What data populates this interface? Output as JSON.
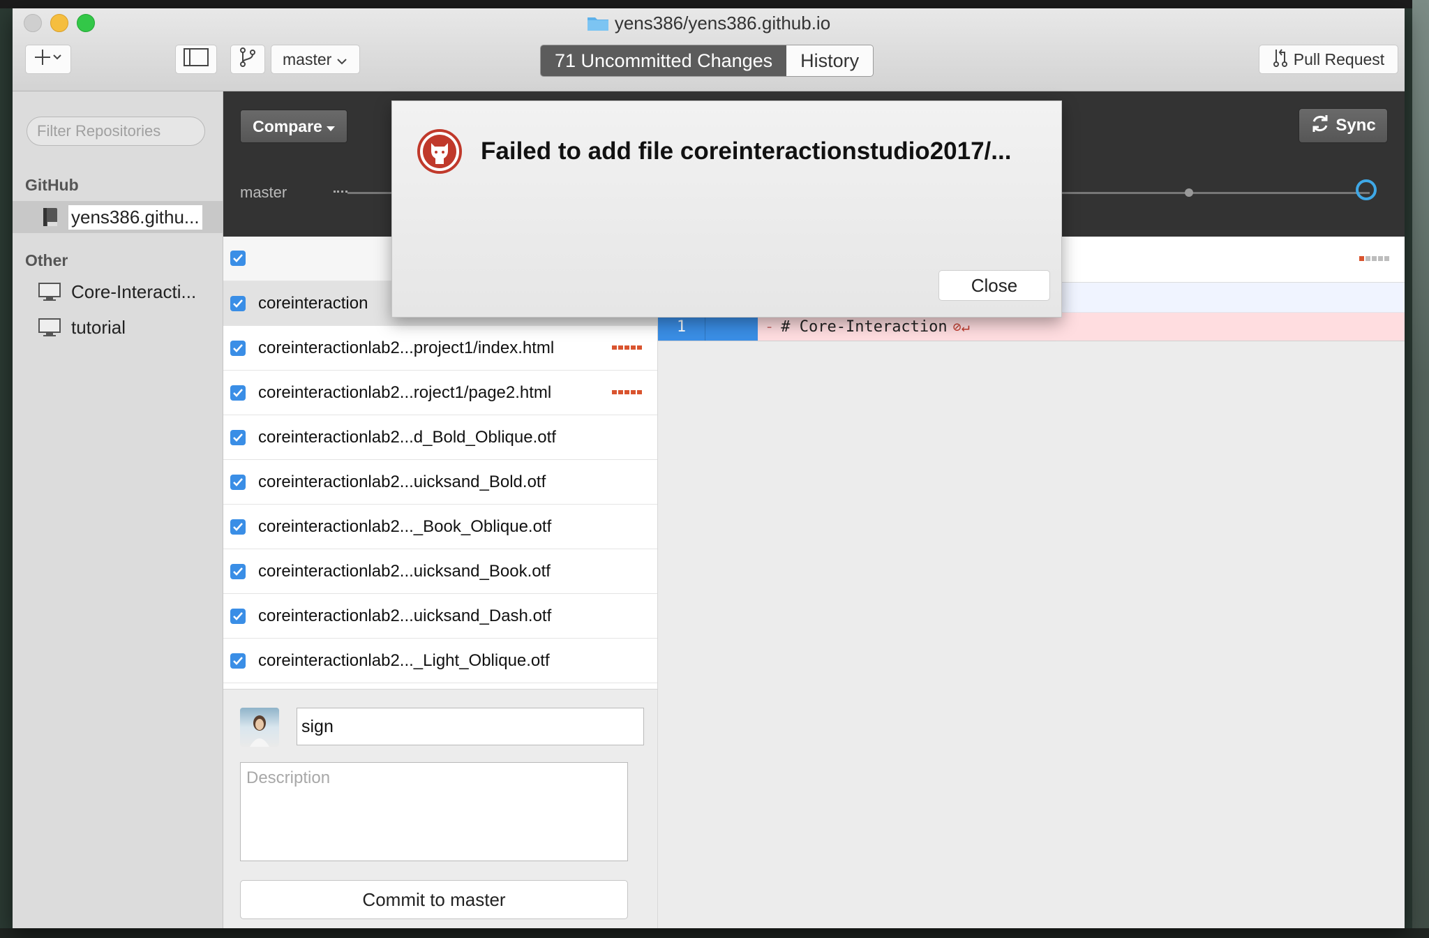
{
  "window": {
    "title": "yens386/yens386.github.io",
    "icon": "folder-icon"
  },
  "toolbar": {
    "add_icon": "plus-icon",
    "sidebar_toggle_icon": "sidebar-icon",
    "branch_icon": "branch-icon",
    "branch_label": "master",
    "tabs": [
      {
        "label": "71 Uncommitted Changes",
        "active": true
      },
      {
        "label": "History",
        "active": false
      }
    ],
    "pull_request_label": "Pull Request"
  },
  "sidebar": {
    "filter_placeholder": "Filter Repositories",
    "github_header": "GitHub",
    "github_items": [
      {
        "label": "yens386.githu...",
        "selected": true
      }
    ],
    "other_header": "Other",
    "other_items": [
      {
        "label": "Core-Interacti..."
      },
      {
        "label": "tutorial"
      }
    ]
  },
  "band": {
    "compare_label": "Compare",
    "sync_label": "Sync",
    "branch_label": "master"
  },
  "files": [
    {
      "name": "coreinteraction",
      "selected": true,
      "changed": false
    },
    {
      "name": "coreinteractionlab2...project1/index.html",
      "changed": true
    },
    {
      "name": "coreinteractionlab2...roject1/page2.html",
      "changed": true
    },
    {
      "name": "coreinteractionlab2...d_Bold_Oblique.otf",
      "changed": false
    },
    {
      "name": "coreinteractionlab2...uicksand_Bold.otf",
      "changed": false
    },
    {
      "name": "coreinteractionlab2..._Book_Oblique.otf",
      "changed": false
    },
    {
      "name": "coreinteractionlab2...uicksand_Book.otf",
      "changed": false
    },
    {
      "name": "coreinteractionlab2...uicksand_Dash.otf",
      "changed": false
    },
    {
      "name": "coreinteractionlab2..._Light_Oblique.otf",
      "changed": false
    }
  ],
  "commit": {
    "summary_value": "sign",
    "description_placeholder": "Description",
    "commit_button": "Commit to master"
  },
  "diff": {
    "line_number": "1",
    "code": "# Core-Interaction"
  },
  "dialog": {
    "title": "Failed to add file coreinteractionstudio2017/...",
    "close_label": "Close",
    "icon": "github-octocat-icon"
  },
  "colors": {
    "accent_blue": "#3a8ee6",
    "deletion_red": "#d9542f",
    "dark_band": "#333333",
    "error_red": "#c0392b"
  }
}
